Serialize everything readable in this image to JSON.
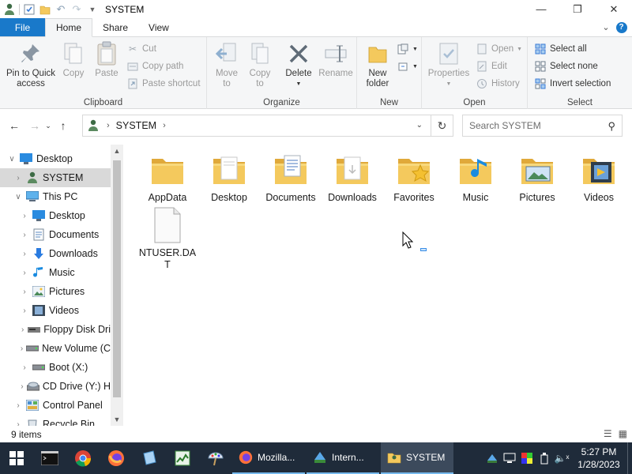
{
  "window": {
    "title": "SYSTEM"
  },
  "ribbon_tabs": [
    "File",
    "Home",
    "Share",
    "View"
  ],
  "ribbon": {
    "clipboard": {
      "label": "Clipboard",
      "pin_line1": "Pin to Quick",
      "pin_line2": "access",
      "copy": "Copy",
      "paste": "Paste",
      "cut": "Cut",
      "copy_path": "Copy path",
      "paste_shortcut": "Paste shortcut"
    },
    "organize": {
      "label": "Organize",
      "move_to_line1": "Move",
      "move_to_line2": "to",
      "copy_to_line1": "Copy",
      "copy_to_line2": "to",
      "delete": "Delete",
      "rename": "Rename"
    },
    "new": {
      "label": "New",
      "new_folder_line1": "New",
      "new_folder_line2": "folder"
    },
    "open": {
      "label": "Open",
      "properties": "Properties",
      "open": "Open",
      "edit": "Edit",
      "history": "History"
    },
    "select": {
      "label": "Select",
      "select_all": "Select all",
      "select_none": "Select none",
      "invert_selection": "Invert selection"
    }
  },
  "address": {
    "crumbs": [
      "SYSTEM"
    ]
  },
  "search": {
    "placeholder": "Search SYSTEM"
  },
  "nav_tree": [
    {
      "label": "Desktop",
      "icon": "desktop-icon",
      "level": 0,
      "expanded": true
    },
    {
      "label": "SYSTEM",
      "icon": "user-icon",
      "level": 1,
      "expanded": false,
      "selected": true
    },
    {
      "label": "This PC",
      "icon": "pc-icon",
      "level": 1,
      "expanded": true
    },
    {
      "label": "Desktop",
      "icon": "desktop-icon",
      "level": 2,
      "expanded": false
    },
    {
      "label": "Documents",
      "icon": "documents-icon",
      "level": 2,
      "expanded": false
    },
    {
      "label": "Downloads",
      "icon": "downloads-icon",
      "level": 2,
      "expanded": false
    },
    {
      "label": "Music",
      "icon": "music-icon",
      "level": 2,
      "expanded": false
    },
    {
      "label": "Pictures",
      "icon": "pictures-icon",
      "level": 2,
      "expanded": false
    },
    {
      "label": "Videos",
      "icon": "videos-icon",
      "level": 2,
      "expanded": false
    },
    {
      "label": "Floppy Disk Dri",
      "icon": "floppy-icon",
      "level": 2,
      "expanded": false
    },
    {
      "label": "New Volume (C",
      "icon": "drive-icon",
      "level": 2,
      "expanded": false
    },
    {
      "label": "Boot (X:)",
      "icon": "drive-icon",
      "level": 2,
      "expanded": false
    },
    {
      "label": "CD Drive (Y:) H",
      "icon": "cd-icon",
      "level": 2,
      "expanded": false
    },
    {
      "label": "Control Panel",
      "icon": "control-panel-icon",
      "level": 1,
      "expanded": false
    },
    {
      "label": "Recycle Bin",
      "icon": "recycle-bin-icon",
      "level": 1,
      "expanded": false
    }
  ],
  "items": [
    {
      "name": "AppData",
      "icon": "folder-icon"
    },
    {
      "name": "Desktop",
      "icon": "desktop-folder-icon"
    },
    {
      "name": "Documents",
      "icon": "documents-folder-icon"
    },
    {
      "name": "Downloads",
      "icon": "downloads-folder-icon"
    },
    {
      "name": "Favorites",
      "icon": "favorites-folder-icon"
    },
    {
      "name": "Music",
      "icon": "music-folder-icon"
    },
    {
      "name": "Pictures",
      "icon": "pictures-folder-icon"
    },
    {
      "name": "Videos",
      "icon": "videos-folder-icon"
    },
    {
      "name": "NTUSER.DA\nT",
      "icon": "file-icon"
    }
  ],
  "status": {
    "count": "9 items"
  },
  "taskbar": {
    "tasks": [
      {
        "label": "Mozilla...",
        "icon": "firefox-icon"
      },
      {
        "label": "Intern...",
        "icon": "internet-icon"
      },
      {
        "label": "SYSTEM",
        "icon": "explorer-icon"
      }
    ],
    "time": "5:27 PM",
    "date": "1/28/2023"
  },
  "colors": {
    "accent": "#1979ca",
    "folder": "#f4c95d",
    "taskbar": "#1f2b3a",
    "selection": "#d9d9d9"
  }
}
